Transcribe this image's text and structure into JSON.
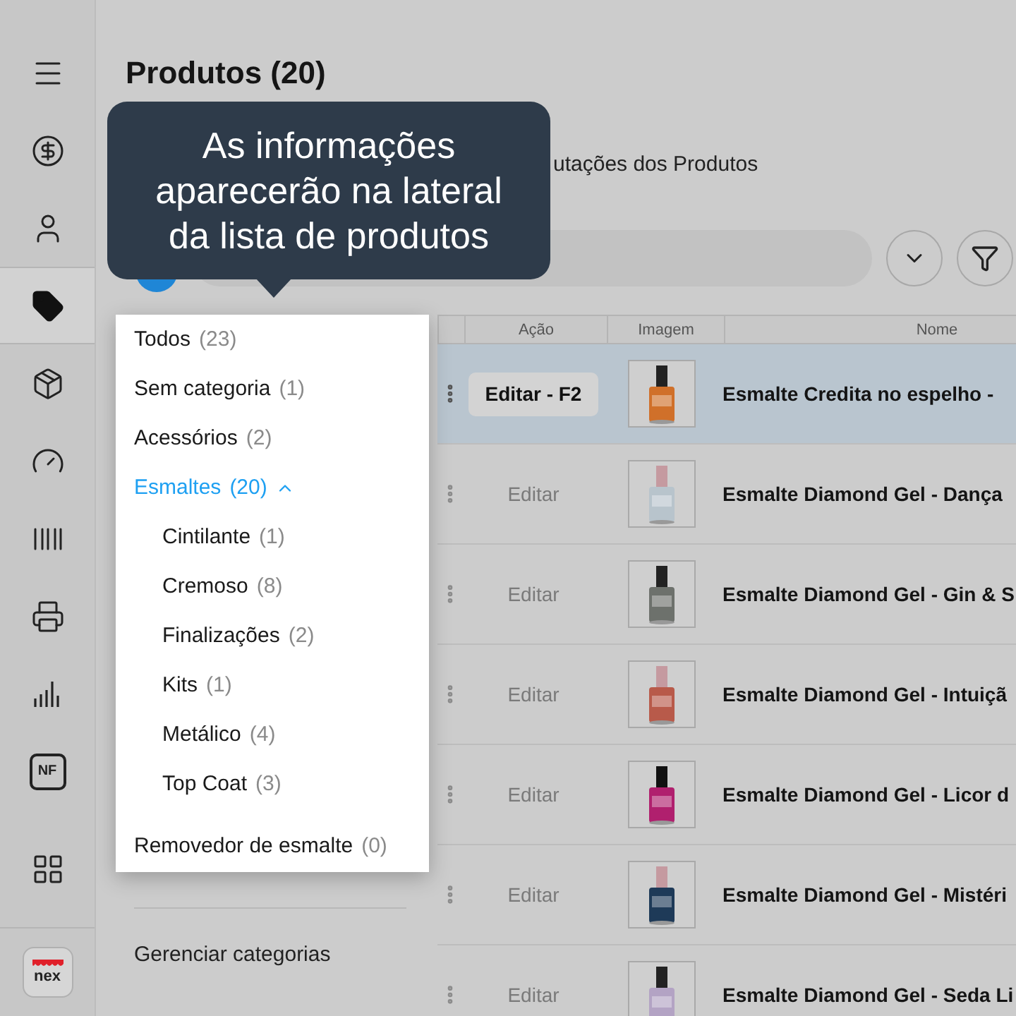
{
  "sidebar": {
    "items": [
      {
        "kind": "menu",
        "selected": false
      },
      {
        "kind": "money",
        "selected": false
      },
      {
        "kind": "user",
        "selected": false
      },
      {
        "kind": "tag",
        "selected": true
      },
      {
        "kind": "box",
        "selected": false
      },
      {
        "kind": "gauge",
        "selected": false
      },
      {
        "kind": "barcode",
        "selected": false
      },
      {
        "kind": "register",
        "selected": false
      },
      {
        "kind": "chart",
        "selected": false
      },
      {
        "kind": "badge",
        "label": "NF",
        "selected": false
      }
    ],
    "bottom": {
      "apps": {
        "kind": "grid"
      },
      "logo": {
        "label": "nex"
      }
    }
  },
  "page": {
    "title": "Produtos (20)",
    "subtitle": "utações dos Produtos"
  },
  "tooltip": {
    "text": "As informações aparecerão na lateral da lista de produtos"
  },
  "categories": [
    {
      "label": "Todos",
      "count": "(23)",
      "selected": false
    },
    {
      "label": "Sem categoria",
      "count": "(1)",
      "selected": false
    },
    {
      "label": "Acessórios",
      "count": "(2)",
      "selected": false
    },
    {
      "label": "Esmaltes",
      "count": "(20)",
      "selected": true,
      "expanded": true,
      "children": [
        {
          "label": "Cintilante",
          "count": "(1)",
          "selected": false
        },
        {
          "label": "Cremoso",
          "count": "(8)",
          "selected": false
        },
        {
          "label": "Finalizações",
          "count": "(2)",
          "selected": false
        },
        {
          "label": "Kits",
          "count": "(1)",
          "selected": false
        },
        {
          "label": "Metálico",
          "count": "(4)",
          "selected": false
        },
        {
          "label": "Top Coat",
          "count": "(3)",
          "selected": false
        }
      ]
    },
    {
      "label": "Removedor de esmalte",
      "count": "(0)",
      "selected": false
    }
  ],
  "manage_link": "Gerenciar categorias",
  "table": {
    "columns": [
      "Ação",
      "Imagem",
      "Nome"
    ],
    "rows": [
      {
        "action": "Editar - F2",
        "name": "Esmalte Credita no espelho -",
        "selected": true
      },
      {
        "action": "Editar",
        "name": "Esmalte Diamond Gel - Dança",
        "selected": false
      },
      {
        "action": "Editar",
        "name": "Esmalte Diamond Gel - Gin & S",
        "selected": false
      },
      {
        "action": "Editar",
        "name": "Esmalte Diamond Gel - Intuiçã",
        "selected": false
      },
      {
        "action": "Editar",
        "name": "Esmalte Diamond Gel - Licor d",
        "selected": false
      },
      {
        "action": "Editar",
        "name": "Esmalte Diamond Gel - Mistéri",
        "selected": false
      },
      {
        "action": "Editar",
        "name": "Esmalte Diamond Gel - Seda Li",
        "selected": false
      }
    ]
  }
}
